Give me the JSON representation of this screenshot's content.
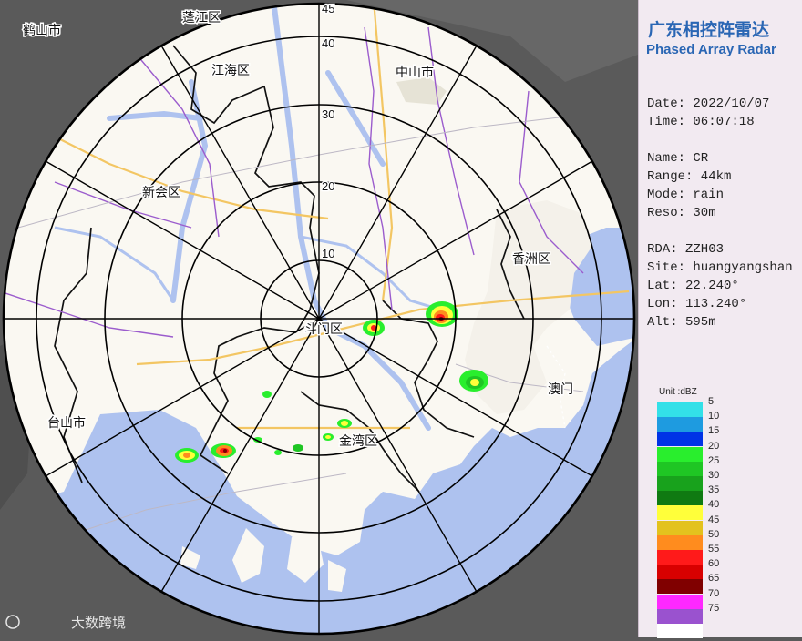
{
  "header": {
    "title_cn": "广东相控阵雷达",
    "title_en": "Phased Array Radar"
  },
  "info": {
    "date": "Date: 2022/10/07",
    "time": "Time: 06:07:18",
    "name": "Name: CR",
    "range": "Range: 44km",
    "mode": "Mode: rain",
    "reso": "Reso: 30m",
    "rda": "RDA: ZZH03",
    "site": "Site: huangyangshan",
    "lat": "Lat: 22.240°",
    "lon": "Lon: 113.240°",
    "alt": "Alt: 595m"
  },
  "legend": {
    "unit": "Unit :dBZ",
    "items": [
      {
        "label": "5",
        "color": "#33e0e8"
      },
      {
        "label": "10",
        "color": "#1e9be0"
      },
      {
        "label": "15",
        "color": "#0033e6"
      },
      {
        "label": "20",
        "color": "#29ee2d"
      },
      {
        "label": "25",
        "color": "#1fc624"
      },
      {
        "label": "30",
        "color": "#18a21c"
      },
      {
        "label": "35",
        "color": "#0f7a12"
      },
      {
        "label": "40",
        "color": "#ffff3a"
      },
      {
        "label": "45",
        "color": "#e3c21e"
      },
      {
        "label": "50",
        "color": "#ff8c1e"
      },
      {
        "label": "55",
        "color": "#ff1a1a"
      },
      {
        "label": "60",
        "color": "#d80000"
      },
      {
        "label": "65",
        "color": "#800000"
      },
      {
        "label": "70",
        "color": "#ff28ff"
      },
      {
        "label": "75",
        "color": "#9a52cf"
      },
      {
        "label": "",
        "color": "#ffffff"
      }
    ]
  },
  "map": {
    "places": [
      {
        "name": "鹤山市"
      },
      {
        "name": "蓬江区"
      },
      {
        "name": "江海区"
      },
      {
        "name": "中山市"
      },
      {
        "name": "新会区"
      },
      {
        "name": "香洲区"
      },
      {
        "name": "斗门区"
      },
      {
        "name": "台山市"
      },
      {
        "name": "金湾区"
      },
      {
        "name": "澳门"
      }
    ],
    "ring_labels": [
      "10",
      "20",
      "30",
      "40",
      "45"
    ]
  },
  "watermark": "大数跨境",
  "colors": {
    "sea": "#aec2ef",
    "land": "#faf8f2",
    "outside": "#5b5b5b",
    "panel_bg": "#f2eaf1",
    "title": "#2a66b4"
  }
}
